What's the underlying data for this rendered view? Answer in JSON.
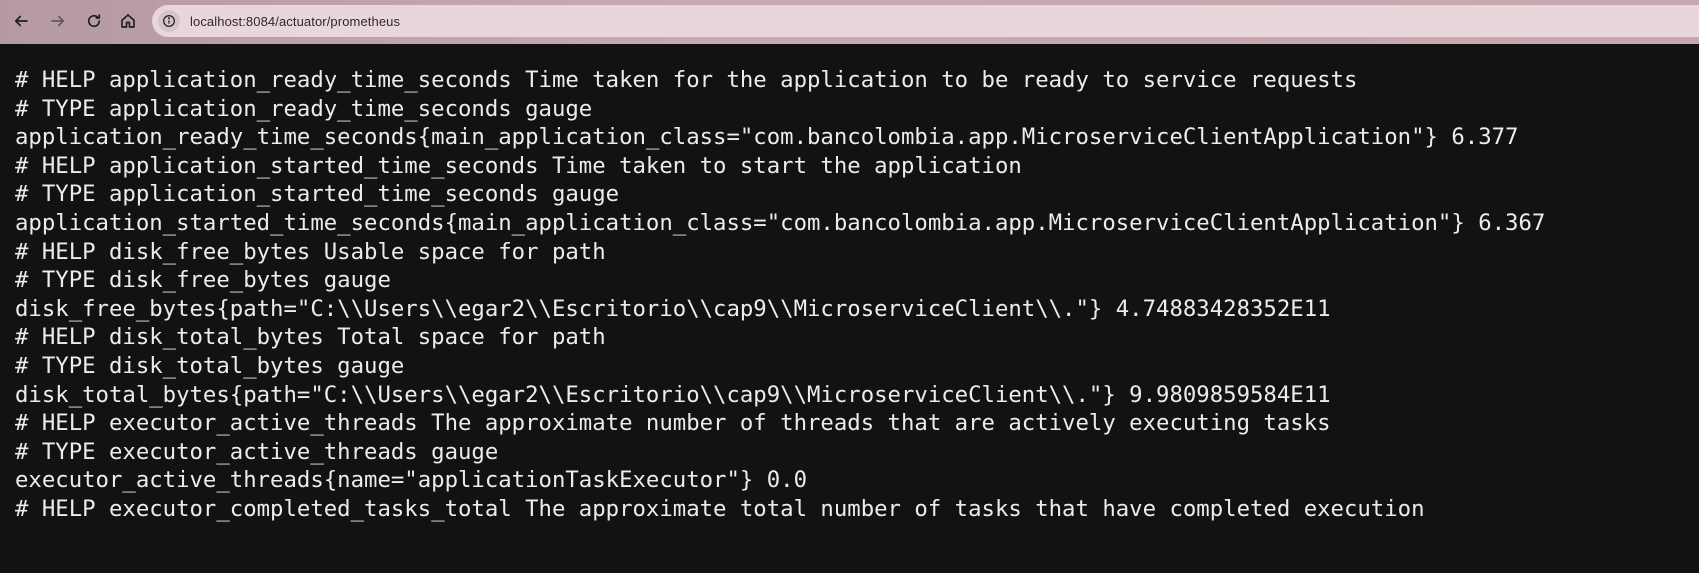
{
  "browser": {
    "url": "localhost:8084/actuator/prometheus",
    "icons": {
      "back": "arrow-left-icon",
      "forward": "arrow-right-icon",
      "reload": "reload-icon",
      "home": "home-icon",
      "site_info": "site-info-icon"
    }
  },
  "page": {
    "lines": [
      "# HELP application_ready_time_seconds Time taken for the application to be ready to service requests",
      "# TYPE application_ready_time_seconds gauge",
      "application_ready_time_seconds{main_application_class=\"com.bancolombia.app.MicroserviceClientApplication\"} 6.377",
      "# HELP application_started_time_seconds Time taken to start the application",
      "# TYPE application_started_time_seconds gauge",
      "application_started_time_seconds{main_application_class=\"com.bancolombia.app.MicroserviceClientApplication\"} 6.367",
      "# HELP disk_free_bytes Usable space for path",
      "# TYPE disk_free_bytes gauge",
      "disk_free_bytes{path=\"C:\\\\Users\\\\egar2\\\\Escritorio\\\\cap9\\\\MicroserviceClient\\\\.\"} 4.74883428352E11",
      "# HELP disk_total_bytes Total space for path",
      "# TYPE disk_total_bytes gauge",
      "disk_total_bytes{path=\"C:\\\\Users\\\\egar2\\\\Escritorio\\\\cap9\\\\MicroserviceClient\\\\.\"} 9.9809859584E11",
      "# HELP executor_active_threads The approximate number of threads that are actively executing tasks",
      "# TYPE executor_active_threads gauge",
      "executor_active_threads{name=\"applicationTaskExecutor\"} 0.0",
      "# HELP executor_completed_tasks_total The approximate total number of tasks that have completed execution"
    ]
  }
}
